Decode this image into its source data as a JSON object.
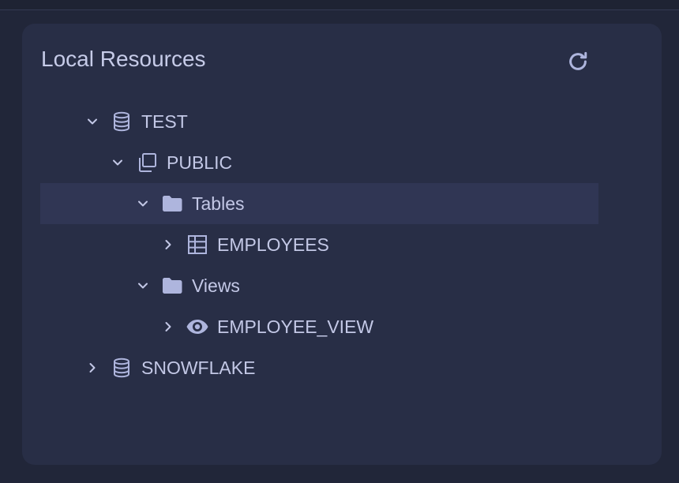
{
  "panel": {
    "title": "Local Resources",
    "refresh_icon": "refresh-icon"
  },
  "tree": [
    {
      "label": "TEST",
      "icon": "database-icon",
      "expanded": true
    },
    {
      "label": "PUBLIC",
      "icon": "schema-icon",
      "expanded": true
    },
    {
      "label": "Tables",
      "icon": "folder-icon",
      "expanded": true,
      "selected": true
    },
    {
      "label": "EMPLOYEES",
      "icon": "table-icon",
      "expanded": false
    },
    {
      "label": "Views",
      "icon": "folder-icon",
      "expanded": true
    },
    {
      "label": "EMPLOYEE_VIEW",
      "icon": "eye-icon",
      "expanded": false
    },
    {
      "label": "SNOWFLAKE",
      "icon": "database-icon",
      "expanded": false
    }
  ],
  "colors": {
    "background": "#212639",
    "panel": "#282e46",
    "selected_row": "#303654",
    "text": "#c3c8e6",
    "icon": "#aeb5dd"
  }
}
